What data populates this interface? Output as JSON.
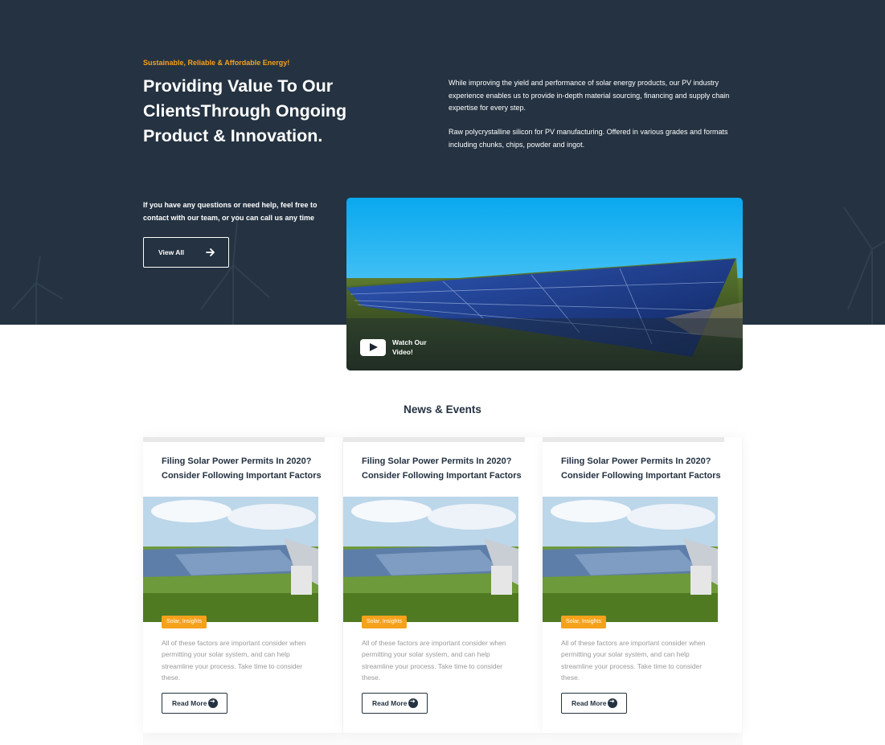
{
  "hero": {
    "tagline": "Sustainable, Reliable & Affordable Energy!",
    "title": "Providing Value To Our ClientsThrough Ongoing Product & Innovation.",
    "paragraph_1": "While improving the yield and performance of solar energy products, our PV industry experience enables us to provide in-depth material sourcing, financing and supply chain expertise for every step.",
    "paragraph_2": "Raw polycrystalline silicon for PV manufacturing. Offered in various grades and formats including chunks, chips, powder and ingot.",
    "help_text": "If you have any questions or need help, feel free to contact with our team, or you can call us any time",
    "view_all_label": "View All",
    "video_label": "Watch Our Video!"
  },
  "news": {
    "section_title": "News & Events",
    "cards": [
      {
        "title": "Filing Solar Power Permits In 2020? Consider Following Important Factors",
        "category": "Solar, Insights",
        "excerpt": "All of these factors are important consider when permitting your solar system, and can help streamline your process. Take time to consider these.",
        "button_label": "Read More"
      },
      {
        "title": "Filing Solar Power Permits In 2020? Consider Following Important Factors",
        "category": "Solar, Insights",
        "excerpt": "All of these factors are important consider when permitting your solar system, and can help streamline your process. Take time to consider these.",
        "button_label": "Read More"
      },
      {
        "title": "Filing Solar Power Permits In 2020? Consider Following Important Factors",
        "category": "Solar, Insights",
        "excerpt": "All of these factors are important consider when permitting your solar system, and can help streamline your process. Take time to consider these.",
        "button_label": "Read More"
      }
    ]
  },
  "icons": {
    "view_all": "arrow-right-icon",
    "video": "play-icon",
    "read_more": "arrow-circle-right-icon"
  },
  "colors": {
    "hero_background": "#243241",
    "accent": "#f5a11b",
    "heading": "#243241",
    "body_text": "#9a9a9a"
  }
}
